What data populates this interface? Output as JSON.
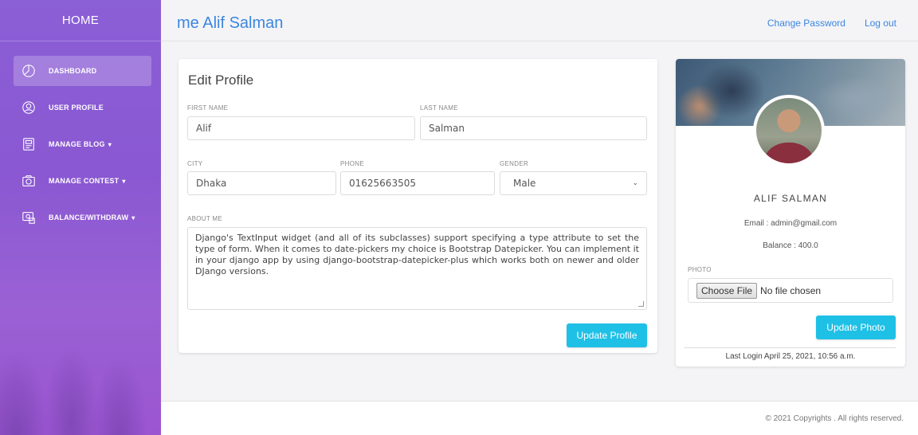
{
  "sidebar": {
    "brand": "HOME",
    "items": [
      {
        "label": "DASHBOARD",
        "icon": "dashboard-icon",
        "caret": ""
      },
      {
        "label": "USER PROFILE",
        "icon": "user-icon",
        "caret": ""
      },
      {
        "label": "MANAGE BLOG",
        "icon": "blog-icon",
        "caret": "▾"
      },
      {
        "label": "MANAGE CONTEST",
        "icon": "camera-icon",
        "caret": "▾"
      },
      {
        "label": "BALANCE/WITHDRAW",
        "icon": "wallet-icon",
        "caret": "▾"
      }
    ]
  },
  "header": {
    "welcome": "me Alif Salman",
    "change_password": "Change Password",
    "logout": "Log out"
  },
  "edit_profile": {
    "title": "Edit Profile",
    "first_name_label": "FIRST NAME",
    "first_name": "Alif",
    "last_name_label": "LAST NAME",
    "last_name": "Salman",
    "city_label": "CITY",
    "city": "Dhaka",
    "phone_label": "PHONE",
    "phone": "01625663505",
    "gender_label": "GENDER",
    "gender": "Male",
    "about_label": "ABOUT ME",
    "about": "Django's TextInput widget (and all of its subclasses) support specifying a type attribute to set the type of form. When it comes to date-pickers my choice is Bootstrap Datepicker. You can implement it in your django app by using django-bootstrap-datepicker-plus which works both on newer and older DJango versions.",
    "update_button": "Update Profile"
  },
  "profile_card": {
    "name": "ALIF SALMAN",
    "email": "Email : admin@gmail.com",
    "balance": "Balance : 400.0",
    "photo_label": "PHOTO",
    "choose_file": "Choose File",
    "no_file": "No file chosen",
    "update_photo": "Update Photo",
    "last_login": "Last Login April 25, 2021, 10:56 a.m."
  },
  "footer": {
    "copyright": "© 2021 Copyrights . All rights reserved."
  },
  "colors": {
    "accent": "#1fc0e6",
    "link": "#3b86e0",
    "sidebar": "#8b5fd6"
  }
}
